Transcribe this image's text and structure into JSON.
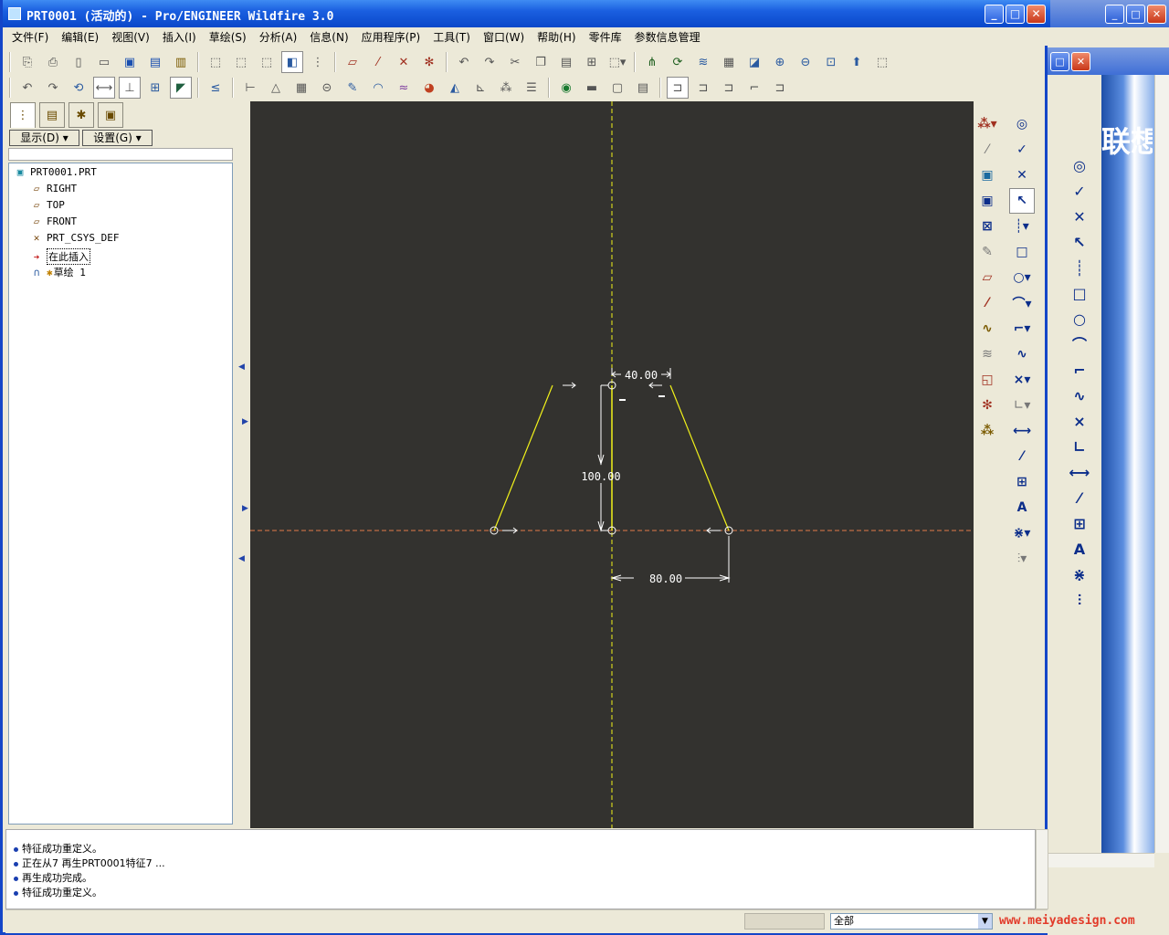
{
  "window": {
    "title": "PRT0001 (活动的) - Pro/ENGINEER Wildfire 3.0",
    "minimize": "_",
    "maximize": "□",
    "close": "✕"
  },
  "menu": [
    "文件(F)",
    "编辑(E)",
    "视图(V)",
    "插入(I)",
    "草绘(S)",
    "分析(A)",
    "信息(N)",
    "应用程序(P)",
    "工具(T)",
    "窗口(W)",
    "帮助(H)",
    "零件库",
    "参数信息管理"
  ],
  "left_panel": {
    "show_button": "显示(D)",
    "settings_button": "设置(G)",
    "tree": [
      {
        "label": "PRT0001.PRT",
        "icon": "part-icon"
      },
      {
        "label": "RIGHT",
        "icon": "datum-plane-icon"
      },
      {
        "label": "TOP",
        "icon": "datum-plane-icon"
      },
      {
        "label": "FRONT",
        "icon": "datum-plane-icon"
      },
      {
        "label": "PRT_CSYS_DEF",
        "icon": "csys-icon"
      },
      {
        "label": "在此插入",
        "icon": "insert-arrow-icon"
      },
      {
        "label": "草绘 1",
        "icon": "sketch-icon"
      }
    ]
  },
  "sketch": {
    "dimensions": {
      "top_width": "40.00",
      "height": "100.00",
      "half_base": "80.00"
    },
    "colors": {
      "geometry": "#f2f21a",
      "centerline_h": "#e07a4a",
      "centerline_v": "#f2f21a",
      "canvas_bg": "#33322f"
    }
  },
  "messages": [
    "特征成功重定义。",
    "正在从7 再生PRT0001特征7 ...",
    "再生成功完成。",
    "特征成功重定义。"
  ],
  "status": {
    "filter_value": "全部"
  },
  "watermark": "www.meiyadesign.com",
  "background_window": {
    "brand_text": "联想"
  },
  "icons": {
    "toolbar1": [
      "new-icon",
      "open-icon",
      "folder-icon",
      "save-icon",
      "save-copy-icon",
      "print-icon",
      "view1-icon",
      "view2-icon",
      "view3-icon",
      "shaded-icon",
      "tree-icon",
      "datum-plane-icon",
      "axis-icon",
      "point-icon",
      "csys-icon",
      "undo-icon",
      "redo-icon",
      "cut-icon",
      "copy-icon",
      "paste-icon",
      "paste-special-icon",
      "select-box-icon",
      "sketch-rel-icon",
      "refit-icon",
      "layers-icon",
      "view-manager-icon",
      "saved-views-icon",
      "zoom-in-icon",
      "zoom-out-icon",
      "refit-window-icon",
      "reorient-icon",
      "spin-center-icon"
    ],
    "toolbar2": [
      "undo-icon",
      "redo-icon",
      "regen-icon",
      "dim-display-icon",
      "constraint-display-icon",
      "grid-icon",
      "vertex-display-icon",
      "sketch-orient-icon",
      "dim-icon",
      "dim2-icon",
      "table-icon",
      "sketcher-icon",
      "wire-icon",
      "hidden-icon",
      "appearance-icon",
      "model-icon",
      "settings-icon",
      "tools-icon",
      "globe-icon",
      "movie-icon",
      "info-icon",
      "layers2-icon",
      "mode1-icon",
      "mode2-icon",
      "mode3-icon",
      "mode4-icon",
      "mode5-icon"
    ]
  }
}
